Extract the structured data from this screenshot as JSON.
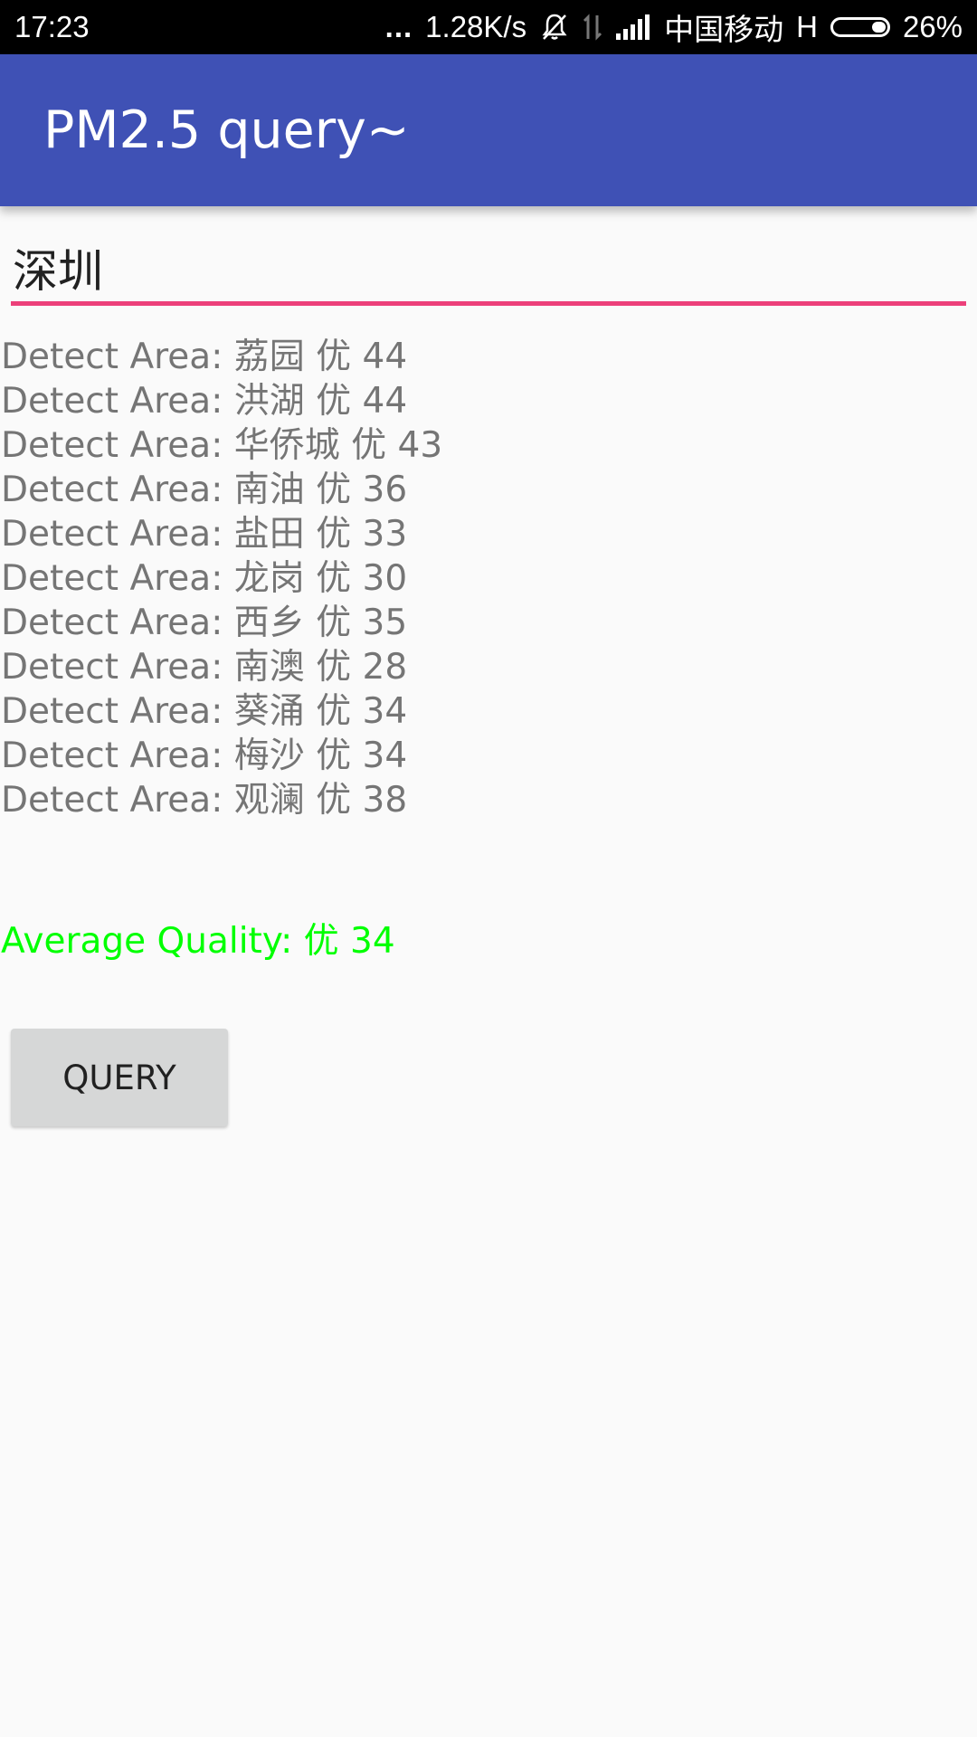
{
  "status_bar": {
    "time": "17:23",
    "dots": "...",
    "network_speed": "1.28K/s",
    "carrier": "中国移动",
    "network_type": "H",
    "battery_percent_label": "26%",
    "battery_level": 0.26,
    "icons": [
      "mute-bell-icon",
      "data-transfer-icon",
      "signal-bars-icon",
      "battery-icon"
    ]
  },
  "app_bar": {
    "title": "PM2.5 query~",
    "color": "#3f51b5"
  },
  "city_input": {
    "value": "深圳",
    "underline_color": "#ec407a"
  },
  "results": [
    {
      "text": "Detect Area: 荔园 优 44"
    },
    {
      "text": "Detect Area: 洪湖 优 44"
    },
    {
      "text": "Detect Area: 华侨城 优 43"
    },
    {
      "text": "Detect Area: 南油 优 36"
    },
    {
      "text": "Detect Area: 盐田 优 33"
    },
    {
      "text": "Detect Area: 龙岗 优 30"
    },
    {
      "text": "Detect Area: 西乡 优 35"
    },
    {
      "text": "Detect Area: 南澳 优 28"
    },
    {
      "text": "Detect Area: 葵涌 优 34"
    },
    {
      "text": "Detect Area: 梅沙 优 34"
    },
    {
      "text": "Detect Area: 观澜 优 38"
    }
  ],
  "average": {
    "text": "Average Quality: 优 34",
    "color": "#00ff00"
  },
  "query_button": {
    "label": "QUERY"
  }
}
